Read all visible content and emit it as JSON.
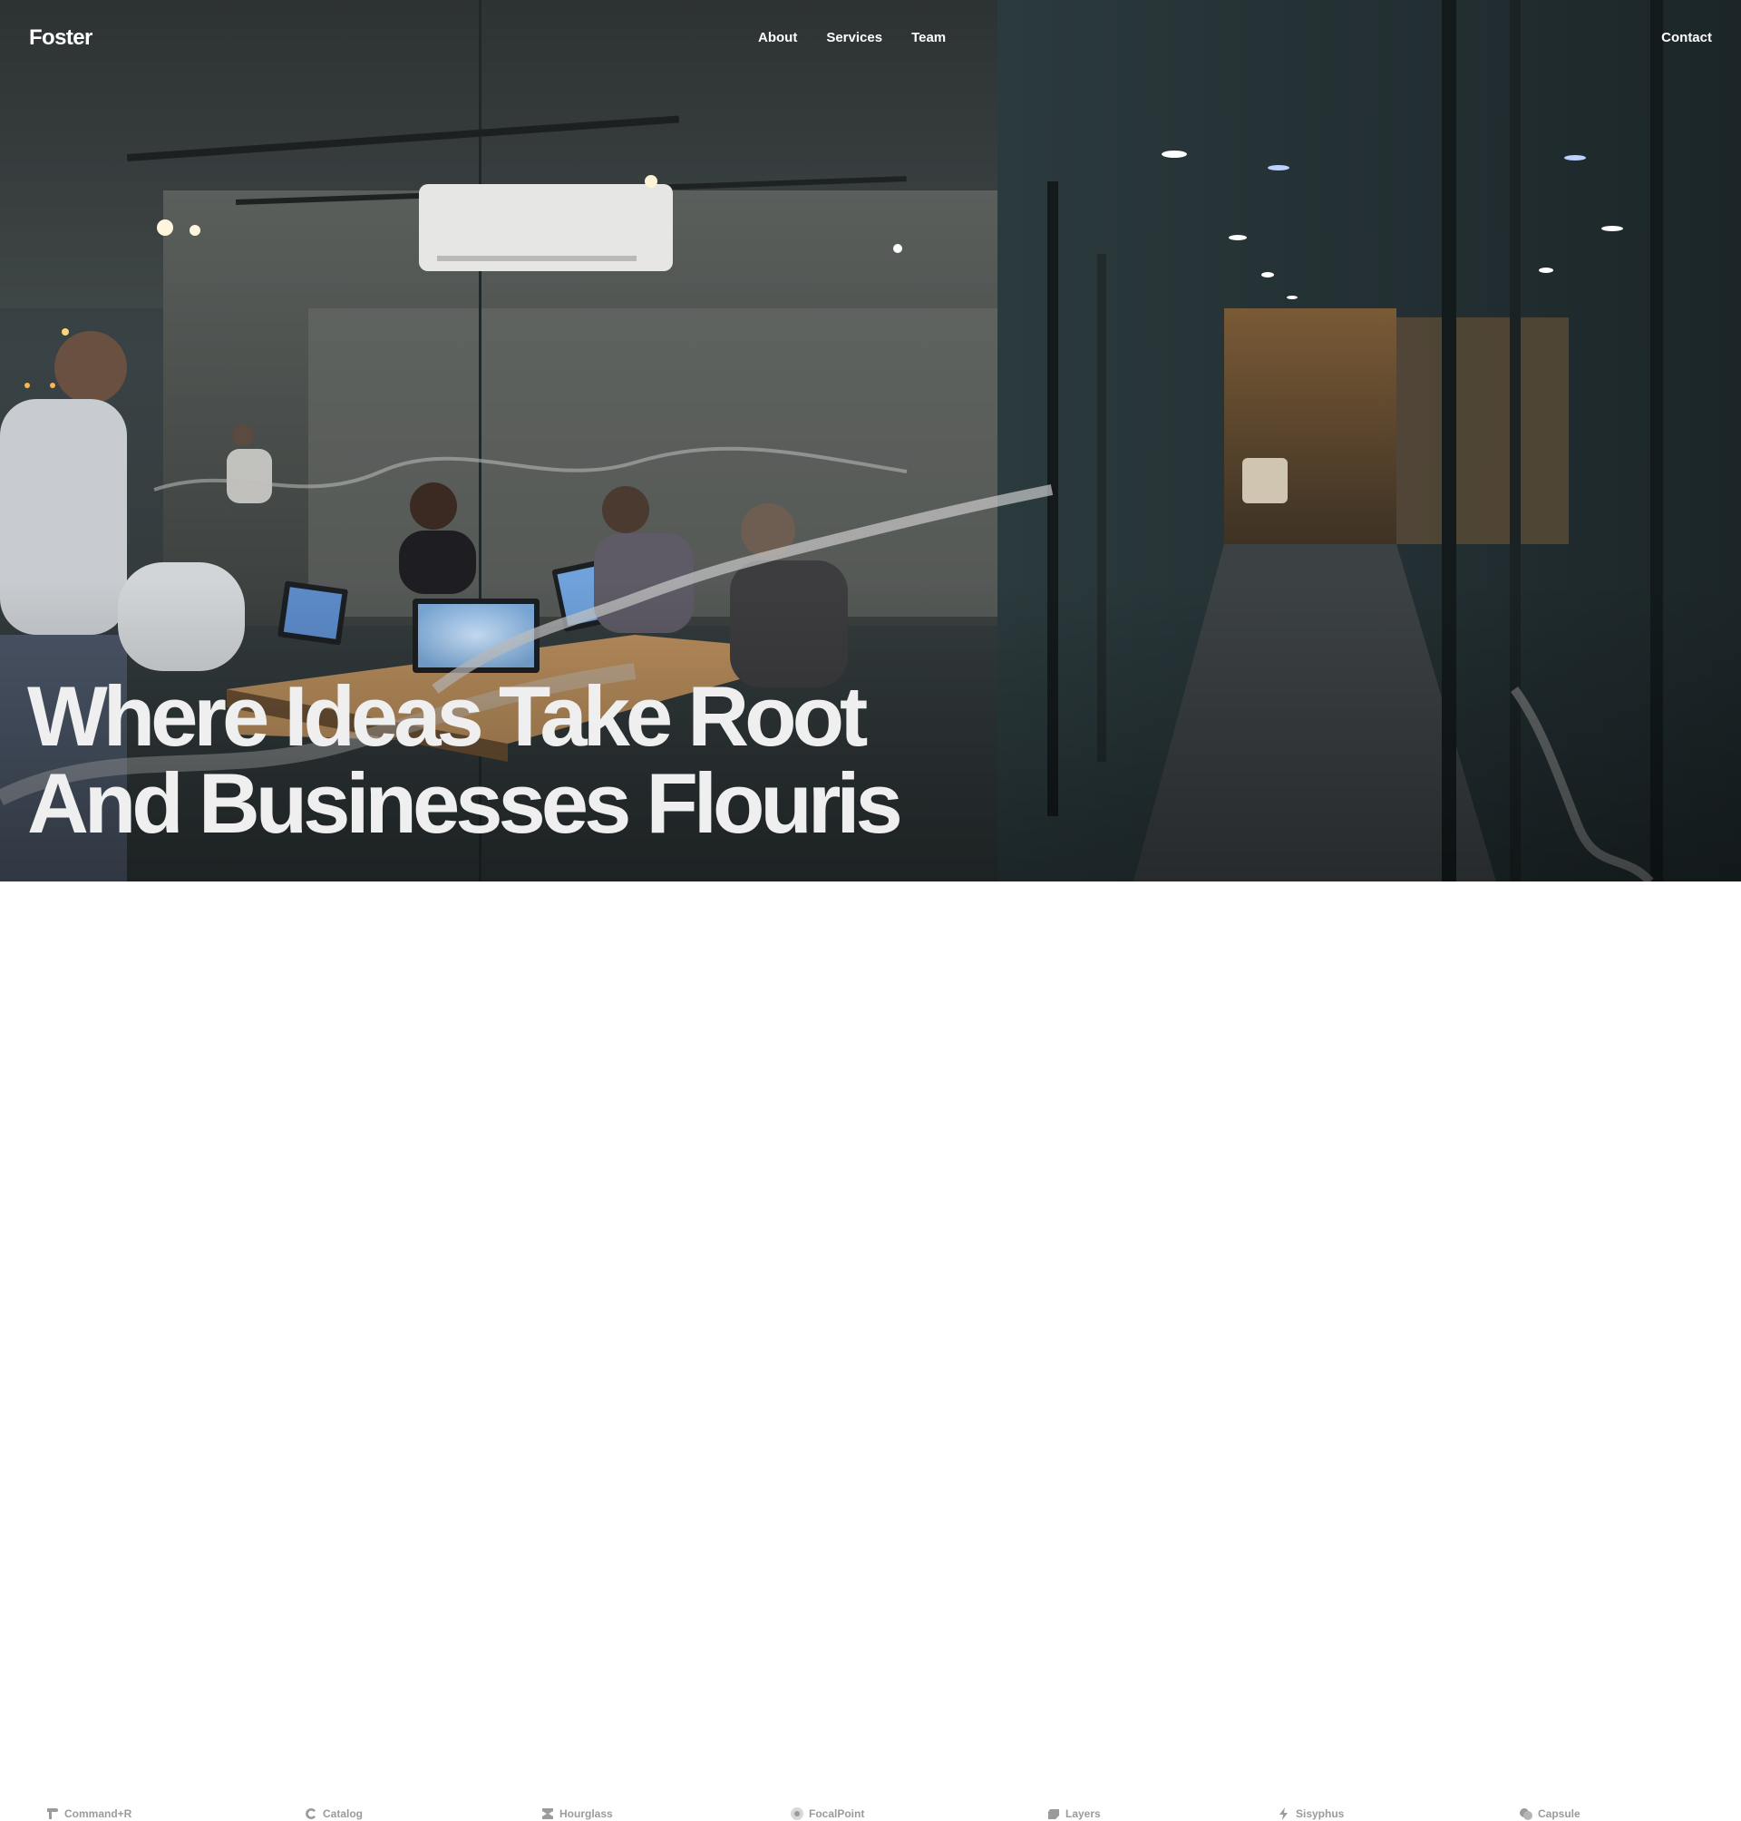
{
  "nav": {
    "logo": "Foster",
    "links": [
      "About",
      "Services",
      "Team"
    ],
    "contact": "Contact"
  },
  "hero": {
    "headline_line1": "Where Ideas Take Root",
    "headline_line2": "And Businesses Flourish"
  },
  "brands": [
    {
      "name": "Command+R",
      "icon": "command-r-icon"
    },
    {
      "name": "Catalog",
      "icon": "catalog-icon"
    },
    {
      "name": "Hourglass",
      "icon": "hourglass-icon"
    },
    {
      "name": "FocalPoint",
      "icon": "focalpoint-icon"
    },
    {
      "name": "Layers",
      "icon": "layers-icon"
    },
    {
      "name": "Sisyphus",
      "icon": "sisyphus-icon"
    },
    {
      "name": "Capsule",
      "icon": "capsule-icon"
    }
  ],
  "colors": {
    "headline": "#efefef",
    "nav_text": "#ffffff",
    "brand_text": "#9b9b9b",
    "hero_dark": "#2b3436"
  }
}
